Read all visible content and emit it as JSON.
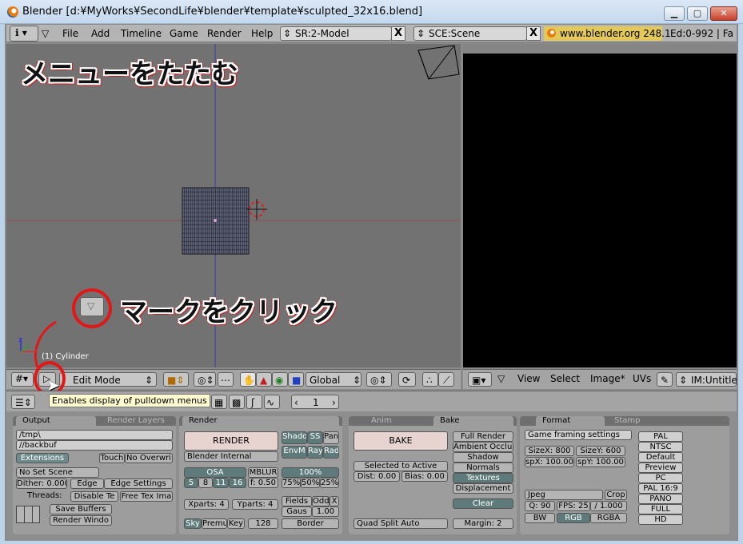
{
  "window": {
    "title": "Blender [d:¥MyWorks¥SecondLife¥blender¥template¥sculpted_32x16.blend]",
    "controls": [
      "minimize",
      "maximize",
      "close"
    ]
  },
  "info_header": {
    "menus": [
      "File",
      "Add",
      "Timeline",
      "Game",
      "Render",
      "Help"
    ],
    "screen_field": "SR:2-Model",
    "scene_field": "SCE:Scene",
    "x_label": "X",
    "site": "www.blender.org 248.1",
    "stats": "Ed:0-992 | Fa"
  },
  "viewport": {
    "annotation_title": "メニューをたたむ",
    "annotation_click": "マークをクリック",
    "object_label": "(1) Cylinder",
    "axis_z": "z",
    "axis_x": "x",
    "header": {
      "mode": "Edit Mode",
      "orientation": "Global"
    }
  },
  "image_header": {
    "menus": [
      "View",
      "Select",
      "Image*",
      "UVs"
    ],
    "image_field": "IM:Untitle"
  },
  "buttons_header": {
    "tooltip": "Enables display of pulldown menus",
    "frame": "1"
  },
  "panels": {
    "output": {
      "tab": "Output",
      "tab2": "Render Layers",
      "path1": "/tmp\\",
      "path2": "//backbuf",
      "extensions": "Extensions",
      "touch": "Touch",
      "no_overwrite": "No Overwri",
      "no_set_scene": "No Set Scene",
      "dither": "Dither: 0.000",
      "edge": "Edge",
      "edge_settings": "Edge Settings",
      "threads": "Threads:",
      "disable_te": "Disable Te",
      "free_tex": "Free Tex Ima",
      "save_buffers": "Save Buffers",
      "render_window": "Render Windo"
    },
    "render": {
      "tab": "Render",
      "render_btn": "RENDER",
      "engine": "Blender Internal",
      "shado": "Shado",
      "ss": "SS",
      "pan": "Pan",
      "envm": "EnvM",
      "ray": "Ray",
      "radi": "Radi",
      "osa": "OSA",
      "mblur": "MBLUR",
      "pct100": "100%",
      "osa5": "5",
      "osa8": "8",
      "osa11": "11",
      "osa16": "16",
      "f050": "f: 0.50",
      "pct75": "75%",
      "pct50": "50%",
      "pct25": "25%",
      "xparts": "Xparts: 4",
      "yparts": "Yparts: 4",
      "fields": "Fields",
      "odd": "Odd",
      "x": "X",
      "gaus": "Gaus",
      "gaus_val": "1.00",
      "sky": "Sky",
      "premu": "Premu",
      "key": "Key",
      "bits": "128",
      "border": "Border"
    },
    "bake": {
      "tab_anim": "Anim",
      "tab_bake": "Bake",
      "bake_btn": "BAKE",
      "full_render": "Full Render",
      "ambient": "Ambient Occlus",
      "shadow": "Shadow",
      "normals": "Normals",
      "textures": "Textures",
      "displacement": "Displacement",
      "selected_to_active": "Selected to Active",
      "dist": "Dist: 0.00",
      "bias": "Bias: 0.00",
      "clear": "Clear",
      "quad_split": "Quad Split Auto",
      "margin": "Margin: 2"
    },
    "format": {
      "tab": "Format",
      "tab2": "Stamp",
      "game_framing": "Game framing settings",
      "sizex": "SizeX: 800",
      "sizey": "SizeY: 600",
      "aspx": "spX: 100.00",
      "aspy": "spY: 100.00",
      "jpeg": "Jpeg",
      "crop": "Crop",
      "q": "Q: 90",
      "fps": "FPS: 25",
      "fps_base": "/ 1.000",
      "bw": "BW",
      "rgb": "RGB",
      "rgba": "RGBA",
      "presets": [
        "PAL",
        "NTSC",
        "Default",
        "Preview",
        "PC",
        "PAL 16:9",
        "PANO",
        "FULL",
        "HD"
      ]
    }
  },
  "colors": {
    "accent_red": "#e01818",
    "viewport_bg": "#727272",
    "panel_bg": "#9d9d9d"
  }
}
